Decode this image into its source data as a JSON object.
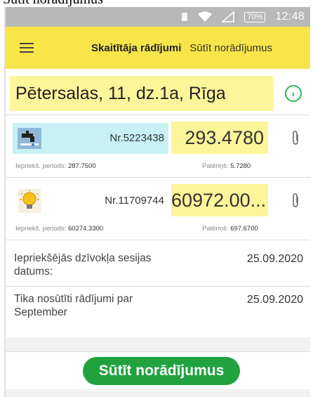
{
  "caption": "Sūtīt norādījumus\"",
  "status_bar": {
    "battery": "70%",
    "time": "12:48",
    "icons": [
      "notification-icon",
      "wifi-icon",
      "signal-icon",
      "battery-icon"
    ]
  },
  "app_bar": {
    "menu_icon": "hamburger-menu-icon",
    "tab_active": "Skaitītāja rādījumi",
    "tab_inactive": "Sūtīt norādījumus",
    "accent": "#f7e54a"
  },
  "address": {
    "text": "Pētersalas, 11, dz.1a, Rīga",
    "arrow_icon": "chevron-right-circle-icon"
  },
  "meters": [
    {
      "icon": "water-tap-icon",
      "number": "Nr.5223438",
      "reading": "293.4780",
      "prev_label": "Iepriekš. periods:",
      "prev_value": "287.7500",
      "cons_label": "Patēriņš:",
      "cons_value": "5.7280",
      "attach_icon": "paperclip-icon"
    },
    {
      "icon": "lightbulb-icon",
      "number": "Nr.11709744",
      "reading": "60972.00...",
      "prev_label": "Iepriekš. periods:",
      "prev_value": "60274.3300",
      "cons_label": "Patēriņš:",
      "cons_value": "697.6700",
      "attach_icon": "paperclip-icon"
    }
  ],
  "info": {
    "session_label": "Iepriekšējās dzīvokļa sesijas datums:",
    "session_value": "25.09.2020",
    "sent_label": "Tika nosūtīti rādījumi par September",
    "sent_value": "25.09.2020"
  },
  "send_button": {
    "label": "Sūtīt norādījumus",
    "color": "#21a23f"
  }
}
